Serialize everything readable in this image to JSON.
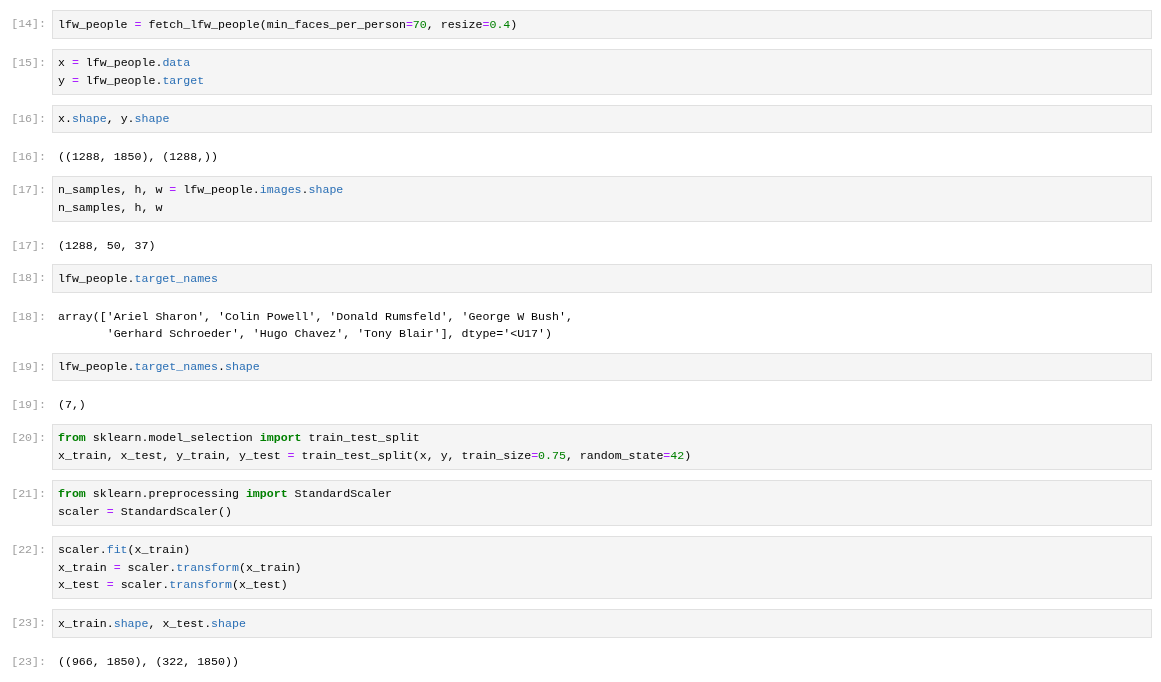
{
  "cells": [
    {
      "kind": "input",
      "prompt": "[14]:",
      "lines": [
        [
          {
            "kind": "plain",
            "s": "lfw_people "
          },
          {
            "kind": "operator",
            "s": "="
          },
          {
            "kind": "plain",
            "s": " fetch_lfw_people(min_faces_per_person"
          },
          {
            "kind": "operator",
            "s": "="
          },
          {
            "kind": "number",
            "s": "70"
          },
          {
            "kind": "plain",
            "s": ", resize"
          },
          {
            "kind": "operator",
            "s": "="
          },
          {
            "kind": "number",
            "s": "0.4"
          },
          {
            "kind": "plain",
            "s": ")"
          }
        ]
      ]
    },
    {
      "kind": "input",
      "prompt": "[15]:",
      "lines": [
        [
          {
            "kind": "plain",
            "s": "x "
          },
          {
            "kind": "operator",
            "s": "="
          },
          {
            "kind": "plain",
            "s": " lfw_people."
          },
          {
            "kind": "attribute",
            "s": "data"
          }
        ],
        [
          {
            "kind": "plain",
            "s": "y "
          },
          {
            "kind": "operator",
            "s": "="
          },
          {
            "kind": "plain",
            "s": " lfw_people."
          },
          {
            "kind": "attribute",
            "s": "target"
          }
        ]
      ]
    },
    {
      "kind": "input",
      "prompt": "[16]:",
      "lines": [
        [
          {
            "kind": "plain",
            "s": "x."
          },
          {
            "kind": "attribute",
            "s": "shape"
          },
          {
            "kind": "plain",
            "s": ", y."
          },
          {
            "kind": "attribute",
            "s": "shape"
          }
        ]
      ]
    },
    {
      "kind": "output",
      "prompt": "[16]:",
      "lines": [
        "((1288, 1850), (1288,))"
      ]
    },
    {
      "kind": "input",
      "prompt": "[17]:",
      "lines": [
        [
          {
            "kind": "plain",
            "s": "n_samples, h, w "
          },
          {
            "kind": "operator",
            "s": "="
          },
          {
            "kind": "plain",
            "s": " lfw_people."
          },
          {
            "kind": "attribute",
            "s": "images"
          },
          {
            "kind": "plain",
            "s": "."
          },
          {
            "kind": "attribute",
            "s": "shape"
          }
        ],
        [
          {
            "kind": "plain",
            "s": "n_samples, h, w"
          }
        ]
      ]
    },
    {
      "kind": "output",
      "prompt": "[17]:",
      "lines": [
        "(1288, 50, 37)"
      ]
    },
    {
      "kind": "input",
      "prompt": "[18]:",
      "lines": [
        [
          {
            "kind": "plain",
            "s": "lfw_people."
          },
          {
            "kind": "attribute",
            "s": "target_names"
          }
        ]
      ]
    },
    {
      "kind": "output",
      "prompt": "[18]:",
      "lines": [
        "array(['Ariel Sharon', 'Colin Powell', 'Donald Rumsfeld', 'George W Bush',",
        "       'Gerhard Schroeder', 'Hugo Chavez', 'Tony Blair'], dtype='<U17')"
      ]
    },
    {
      "kind": "input",
      "prompt": "[19]:",
      "lines": [
        [
          {
            "kind": "plain",
            "s": "lfw_people."
          },
          {
            "kind": "attribute",
            "s": "target_names"
          },
          {
            "kind": "plain",
            "s": "."
          },
          {
            "kind": "attribute",
            "s": "shape"
          }
        ]
      ]
    },
    {
      "kind": "output",
      "prompt": "[19]:",
      "lines": [
        "(7,)"
      ]
    },
    {
      "kind": "input",
      "prompt": "[20]:",
      "lines": [
        [
          {
            "kind": "keyword",
            "s": "from"
          },
          {
            "kind": "plain",
            "s": " sklearn.model_selection "
          },
          {
            "kind": "keyword",
            "s": "import"
          },
          {
            "kind": "plain",
            "s": " train_test_split"
          }
        ],
        [
          {
            "kind": "plain",
            "s": "x_train, x_test, y_train, y_test "
          },
          {
            "kind": "operator",
            "s": "="
          },
          {
            "kind": "plain",
            "s": " train_test_split(x, y, train_size"
          },
          {
            "kind": "operator",
            "s": "="
          },
          {
            "kind": "number",
            "s": "0.75"
          },
          {
            "kind": "plain",
            "s": ", random_state"
          },
          {
            "kind": "operator",
            "s": "="
          },
          {
            "kind": "number",
            "s": "42"
          },
          {
            "kind": "plain",
            "s": ")"
          }
        ]
      ]
    },
    {
      "kind": "input",
      "prompt": "[21]:",
      "lines": [
        [
          {
            "kind": "keyword",
            "s": "from"
          },
          {
            "kind": "plain",
            "s": " sklearn.preprocessing "
          },
          {
            "kind": "keyword",
            "s": "import"
          },
          {
            "kind": "plain",
            "s": " StandardScaler"
          }
        ],
        [
          {
            "kind": "plain",
            "s": "scaler "
          },
          {
            "kind": "operator",
            "s": "="
          },
          {
            "kind": "plain",
            "s": " StandardScaler()"
          }
        ]
      ]
    },
    {
      "kind": "input",
      "prompt": "[22]:",
      "lines": [
        [
          {
            "kind": "plain",
            "s": "scaler."
          },
          {
            "kind": "attribute",
            "s": "fit"
          },
          {
            "kind": "plain",
            "s": "(x_train)"
          }
        ],
        [
          {
            "kind": "plain",
            "s": "x_train "
          },
          {
            "kind": "operator",
            "s": "="
          },
          {
            "kind": "plain",
            "s": " scaler."
          },
          {
            "kind": "attribute",
            "s": "transform"
          },
          {
            "kind": "plain",
            "s": "(x_train)"
          }
        ],
        [
          {
            "kind": "plain",
            "s": "x_test "
          },
          {
            "kind": "operator",
            "s": "="
          },
          {
            "kind": "plain",
            "s": " scaler."
          },
          {
            "kind": "attribute",
            "s": "transform"
          },
          {
            "kind": "plain",
            "s": "(x_test)"
          }
        ]
      ]
    },
    {
      "kind": "input",
      "prompt": "[23]:",
      "lines": [
        [
          {
            "kind": "plain",
            "s": "x_train."
          },
          {
            "kind": "attribute",
            "s": "shape"
          },
          {
            "kind": "plain",
            "s": ", x_test."
          },
          {
            "kind": "attribute",
            "s": "shape"
          }
        ]
      ]
    },
    {
      "kind": "output",
      "prompt": "[23]:",
      "lines": [
        "((966, 1850), (322, 1850))"
      ]
    }
  ]
}
